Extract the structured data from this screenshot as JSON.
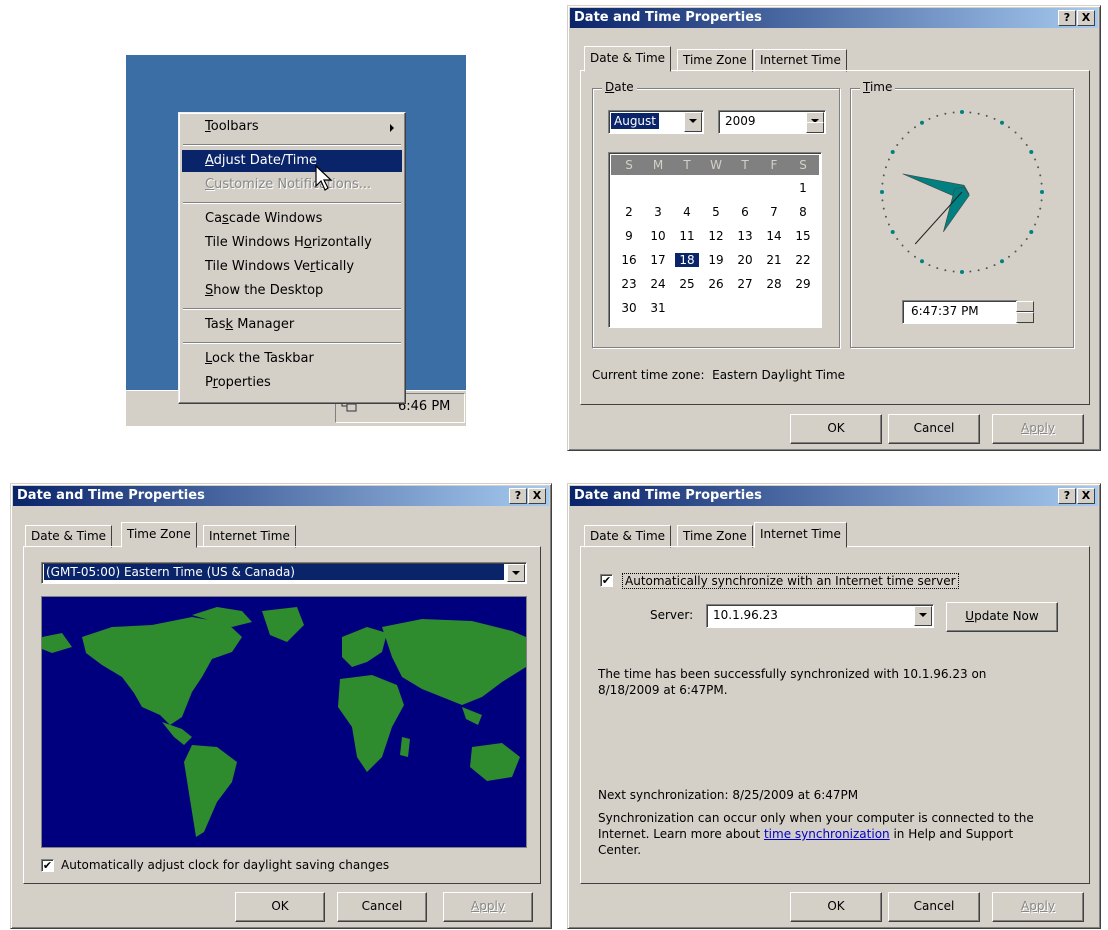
{
  "context_menu": {
    "items": [
      {
        "label": "Toolbars",
        "hotkey": 0,
        "state": "normal",
        "submenu": true
      },
      {
        "label": "Adjust Date/Time",
        "hotkey": 0,
        "state": "highlighted"
      },
      {
        "label": "Customize Notifications...",
        "hotkey": 0,
        "state": "disabled"
      },
      {
        "label": "Cascade Windows",
        "hotkey": 2,
        "state": "normal"
      },
      {
        "label": "Tile Windows Horizontally",
        "hotkey": 14,
        "state": "normal"
      },
      {
        "label": "Tile Windows Vertically",
        "hotkey": 15,
        "state": "normal"
      },
      {
        "label": "Show the Desktop",
        "hotkey": 0,
        "state": "normal"
      },
      {
        "label": "Task Manager",
        "hotkey": 3,
        "state": "normal"
      },
      {
        "label": "Lock the Taskbar",
        "hotkey": 0,
        "state": "normal"
      },
      {
        "label": "Properties",
        "hotkey": 1,
        "state": "normal"
      }
    ],
    "taskbar_clock": "6:46 PM"
  },
  "window_title": "Date and Time Properties",
  "title_buttons": {
    "help": "?",
    "close": "X"
  },
  "tabs": [
    "Date & Time",
    "Time Zone",
    "Internet Time"
  ],
  "buttons": {
    "ok": "OK",
    "cancel": "Cancel",
    "apply": "Apply"
  },
  "date_time_tab": {
    "date_group": "Date",
    "time_group": "Time",
    "month": "August",
    "year": "2009",
    "weekdays": [
      "S",
      "M",
      "T",
      "W",
      "T",
      "F",
      "S"
    ],
    "first_weekday_index": 6,
    "days_in_month": 31,
    "selected_day": 18,
    "time": "6:47:37 PM",
    "current_zone_label": "Current time zone:",
    "current_zone": "Eastern Daylight Time"
  },
  "time_zone_tab": {
    "zone": "(GMT-05:00) Eastern Time (US & Canada)",
    "daylight_checkbox": "Automatically adjust clock for daylight saving changes",
    "daylight_checked": true
  },
  "internet_time_tab": {
    "sync_checkbox": "Automatically synchronize with an Internet time server",
    "sync_checked": true,
    "server_label": "Server:",
    "server": "10.1.96.23",
    "update_button": "Update Now",
    "status_line1": "The time has been successfully synchronized with 10.1.96.23 on",
    "status_line2": "8/18/2009 at 6:47PM.",
    "next_sync": "Next synchronization: 8/25/2009 at 6:47PM",
    "note_line1": "Synchronization can occur only when your computer is connected to the",
    "note_line2_pre": "Internet.  Learn more about ",
    "note_link": "time synchronization",
    "note_line2_post": " in Help and Support",
    "note_line3": "Center."
  },
  "colors": {
    "titlebar": "#0a246a",
    "face": "#d4d0c8",
    "desktop": "#3a6ea5",
    "map_ocean": "#00007f",
    "map_land": "#2e8b2e",
    "clock_hands": "#008080"
  }
}
